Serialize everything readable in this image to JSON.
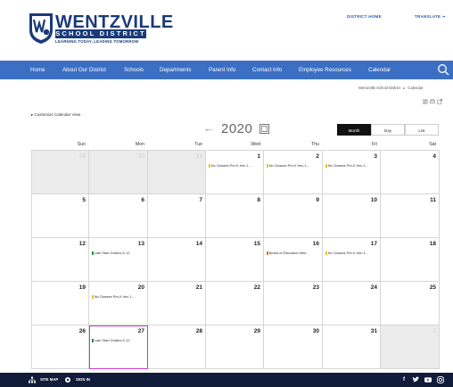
{
  "header": {
    "logo_initials": "WSD",
    "logo_name": "WENTZVILLE",
    "logo_band": "SCHOOL DISTRICT",
    "logo_tagline": "LEARNING TODAY, LEADING TOMORROW",
    "district_home": "DISTRICT HOME",
    "translate": "TRANSLATE",
    "translate_icon": "arrow-right-icon"
  },
  "nav": {
    "items": [
      "Home",
      "About Our District",
      "Schools",
      "Departments",
      "Parent Info",
      "Contact Info",
      "Employee Resources",
      "Calendar"
    ],
    "search_icon": "search-icon"
  },
  "breadcrumb": {
    "items": [
      "Wentzville School District",
      "Calendar"
    ],
    "separator": "▸"
  },
  "tools": [
    "rss-icon",
    "print-icon",
    "share-icon"
  ],
  "calendar": {
    "customize": "Customize Calendar View",
    "year": "2020",
    "views": [
      "Month",
      "Day",
      "List"
    ],
    "active_view": "Month",
    "days_of_week": [
      "Sun",
      "Mon",
      "Tue",
      "Wed",
      "Thu",
      "Fri",
      "Sat"
    ],
    "weeks": [
      [
        {
          "d": "29",
          "o": true
        },
        {
          "d": "30",
          "o": true
        },
        {
          "d": "31",
          "o": true
        },
        {
          "d": "1",
          "ev": "No Classes Pre-K thru 1...",
          "c": "#e6c32b"
        },
        {
          "d": "2",
          "ev": "No Classes Pre-K thru 1...",
          "c": "#e6c32b"
        },
        {
          "d": "3",
          "ev": "No Classes Pre-K thru 1...",
          "c": "#e6c32b"
        },
        {
          "d": "4"
        }
      ],
      [
        {
          "d": "5"
        },
        {
          "d": "6"
        },
        {
          "d": "7"
        },
        {
          "d": "8"
        },
        {
          "d": "9"
        },
        {
          "d": "10"
        },
        {
          "d": "11"
        }
      ],
      [
        {
          "d": "12"
        },
        {
          "d": "13",
          "ev": "Late Start Grades K-12",
          "c": "#2a8a4a"
        },
        {
          "d": "14"
        },
        {
          "d": "15"
        },
        {
          "d": "16",
          "ev": "Board of Education Mee...",
          "c": "#d9732b"
        },
        {
          "d": "17",
          "ev": "No Classes Pre-K thru 1...",
          "c": "#e6c32b"
        },
        {
          "d": "18"
        }
      ],
      [
        {
          "d": "19"
        },
        {
          "d": "20",
          "ev": "No Classes Pre-K thru 1...",
          "c": "#e6c32b"
        },
        {
          "d": "21"
        },
        {
          "d": "22"
        },
        {
          "d": "23"
        },
        {
          "d": "24"
        },
        {
          "d": "25"
        }
      ],
      [
        {
          "d": "26"
        },
        {
          "d": "27",
          "ev": "Late Start Grades K-12",
          "c": "#2a8a4a",
          "sel": true
        },
        {
          "d": "28"
        },
        {
          "d": "29"
        },
        {
          "d": "30"
        },
        {
          "d": "31"
        },
        {
          "d": "1",
          "o": true
        }
      ]
    ]
  },
  "footer": {
    "site_map": "SITE MAP",
    "sign_in": "SIGN IN",
    "social": [
      "facebook-icon",
      "twitter-icon",
      "youtube-icon",
      "instagram-icon"
    ]
  },
  "colors": {
    "nav": "#3b6fc4",
    "brand": "#1a3a78",
    "footer": "#111c3a",
    "selected": "#c83cc8"
  }
}
